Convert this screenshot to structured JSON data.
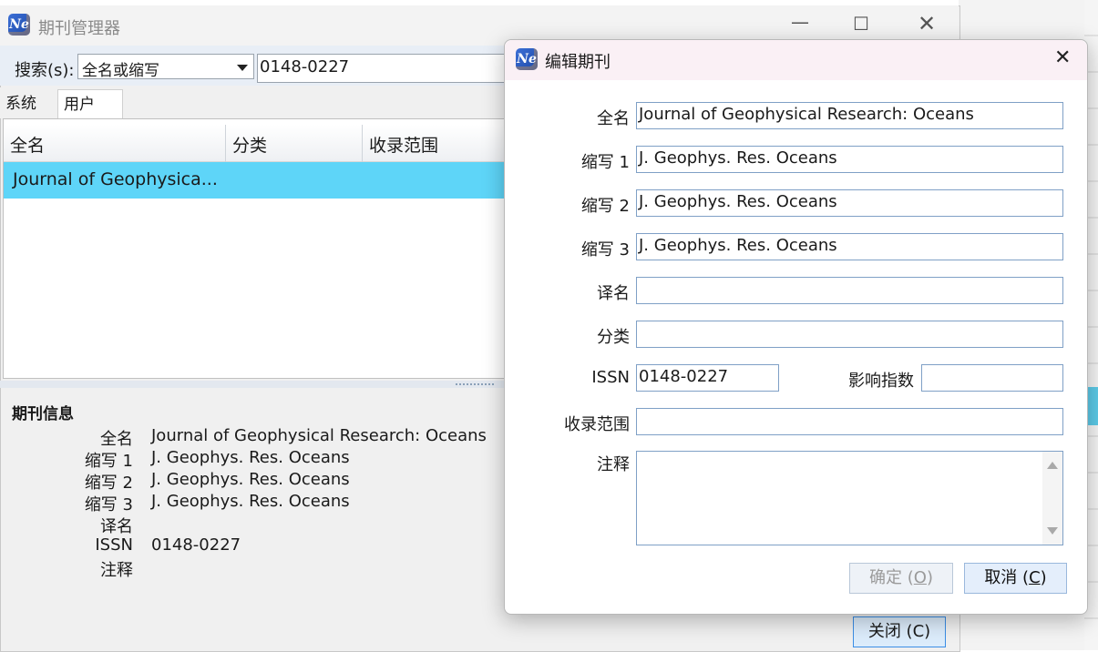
{
  "main_window": {
    "title": "期刊管理器",
    "search_label": "搜索(s):",
    "search_mode": "全名或缩写",
    "search_value": "0148-0227",
    "tabs": [
      "系统",
      "用户"
    ],
    "columns": [
      "全名",
      "分类",
      "收录范围"
    ],
    "selected_row": "Journal of Geophysica...",
    "info_title": "期刊信息",
    "info": {
      "labels": [
        "全名",
        "缩写 1",
        "缩写 2",
        "缩写 3",
        "译名",
        "ISSN",
        "注释"
      ],
      "values": [
        "Journal of Geophysical Research: Oceans",
        "J. Geophys. Res. Oceans",
        "J. Geophys. Res. Oceans",
        "J. Geophys. Res. Oceans",
        "",
        "0148-0227",
        ""
      ]
    },
    "close_button": "关闭 (C)"
  },
  "dialog": {
    "title": "编辑期刊",
    "labels": {
      "full_name": "全名",
      "abbr1": "缩写 1",
      "abbr2": "缩写 2",
      "abbr3": "缩写 3",
      "translation": "译名",
      "category": "分类",
      "issn": "ISSN",
      "impact": "影响指数",
      "coverage": "收录范围",
      "notes": "注释"
    },
    "values": {
      "full_name": "Journal of Geophysical Research: Oceans",
      "abbr1": "J. Geophys. Res. Oceans",
      "abbr2": "J. Geophys. Res. Oceans",
      "abbr3": "J. Geophys. Res. Oceans",
      "translation": "",
      "category": "",
      "issn": "0148-0227",
      "impact": "",
      "coverage": "",
      "notes": ""
    },
    "ok_text": "确定 (",
    "ok_key": "O",
    "cancel_text": "取消 (",
    "cancel_key": "C",
    "paren_close": ")"
  },
  "icons": {
    "app": "Ne"
  }
}
